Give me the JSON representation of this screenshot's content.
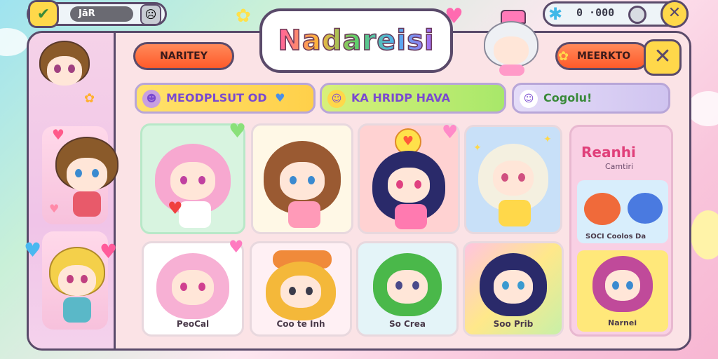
{
  "top_bar": {
    "player_name": "JãR",
    "currency_value": "0 ·000",
    "check_icon": "check-icon",
    "face_icon": "face-icon",
    "gem_icon": "gem-icon",
    "coin_icon": "coin-icon",
    "close_icon": "close-icon"
  },
  "title": {
    "logo_text": "Nadareisi"
  },
  "buttons": {
    "left_button_label": "NARITEY",
    "right_button_label": "MEERKTO"
  },
  "filter_tabs": [
    {
      "label": "MEODPLSUT OD",
      "icon": "face-icon",
      "color": "#ffe26a"
    },
    {
      "label": "KA HRIDP HAVA",
      "icon": "smile-icon",
      "color": "#b8f06a"
    },
    {
      "label": "Cogolu!",
      "icon": "character-icon",
      "color": "#d8ccf0"
    }
  ],
  "grid_cards": [
    {
      "label": "",
      "hair": "#f7a8d0",
      "bg": "#d8f4e0",
      "eye": "#c040a0"
    },
    {
      "label": "",
      "hair": "#9a5a32",
      "bg": "#fff8e6",
      "eye": "#3a8ad0"
    },
    {
      "label": "",
      "hair": "#2a2a6a",
      "bg": "#ffd2d2",
      "eye": "#e04080"
    },
    {
      "label": "",
      "hair": "#f4f0e0",
      "bg": "#c8e0f8",
      "eye": "#d05080"
    },
    {
      "label": "PeoCal",
      "hair": "#f7b0d4",
      "bg": "#ffffff",
      "eye": "#d04090"
    },
    {
      "label": "Coo te Inh",
      "hair": "#f4b83a",
      "bg": "#fff0f4",
      "eye": "#3a3a4a"
    },
    {
      "label": "So Crea",
      "hair": "#4ab84a",
      "bg": "#e4f4f8",
      "eye": "#4a4a8a"
    },
    {
      "label": "Soo Prib",
      "hair": "#2a2a6a",
      "bg": "#ffe28a",
      "eye": "#3a9ad0"
    }
  ],
  "featured_card": {
    "title": "Reanhi",
    "subtitle": "Camtiri",
    "caption": "SOCI Coolos Da",
    "bottom_label": "Narnei"
  },
  "sidebar_characters": [
    {
      "hair": "#8a5a2a"
    },
    {
      "hair": "#8a5a2a"
    },
    {
      "hair": "#f4d04a"
    }
  ]
}
